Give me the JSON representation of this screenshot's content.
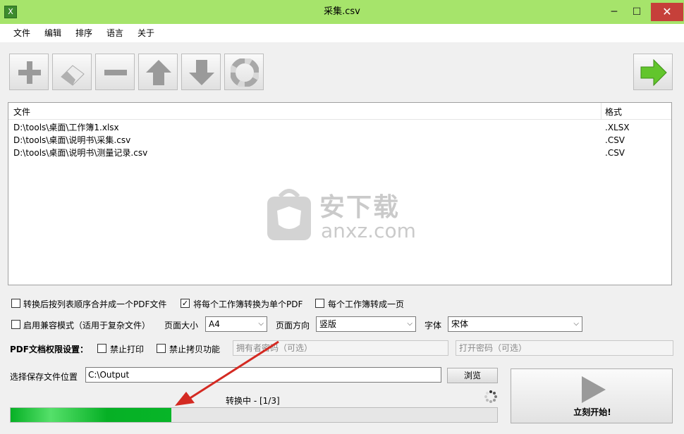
{
  "window": {
    "title": "采集.csv",
    "app_icon_text": "X",
    "minimize": "─",
    "maximize": "☐",
    "close": "✕"
  },
  "menu": [
    "文件",
    "编辑",
    "排序",
    "语言",
    "关于"
  ],
  "toolbar": {
    "buttons": [
      "add-icon",
      "erase-icon",
      "remove-icon",
      "move-up-icon",
      "move-down-icon",
      "help-lifebuoy-icon"
    ],
    "next": "next-arrow-icon"
  },
  "file_list": {
    "columns": [
      "文件",
      "格式"
    ],
    "rows": [
      {
        "path": "D:\\tools\\桌面\\工作簿1.xlsx",
        "format": ".XLSX"
      },
      {
        "path": "D:\\tools\\桌面\\说明书\\采集.csv",
        "format": ".CSV"
      },
      {
        "path": "D:\\tools\\桌面\\说明书\\测量记录.csv",
        "format": ".CSV"
      }
    ]
  },
  "watermark": {
    "line1": "安下载",
    "line2": "anxz.com"
  },
  "options": {
    "merge_label": "转换后按列表顺序合并成一个PDF文件",
    "merge_checked": false,
    "each_workbook_label": "将每个工作簿转换为单个PDF",
    "each_workbook_checked": true,
    "one_page_label": "每个工作簿转成一页",
    "one_page_checked": false,
    "compat_label": "启用兼容模式（适用于复杂文件）",
    "compat_checked": false,
    "page_size_label": "页面大小",
    "page_size_value": "A4",
    "orientation_label": "页面方向",
    "orientation_value": "竖版",
    "font_label": "字体",
    "font_value": "宋体"
  },
  "permissions": {
    "title": "PDF文档权限设置：",
    "no_print_label": "禁止打印",
    "no_print_checked": false,
    "no_copy_label": "禁止拷贝功能",
    "no_copy_checked": false,
    "owner_pwd_placeholder": "拥有者密码（可选）",
    "open_pwd_placeholder": "打开密码（可选）"
  },
  "output": {
    "label": "选择保存文件位置",
    "path": "C:\\Output",
    "browse": "浏览"
  },
  "status": {
    "text": "转换中 - [1/3]",
    "progress": 0.33
  },
  "start_button": {
    "label": "立刻开始!"
  },
  "colors": {
    "titlebar": "#a6e46b",
    "close": "#c6403a",
    "progress": "#06b025",
    "annotation_arrow": "#d42a22"
  }
}
